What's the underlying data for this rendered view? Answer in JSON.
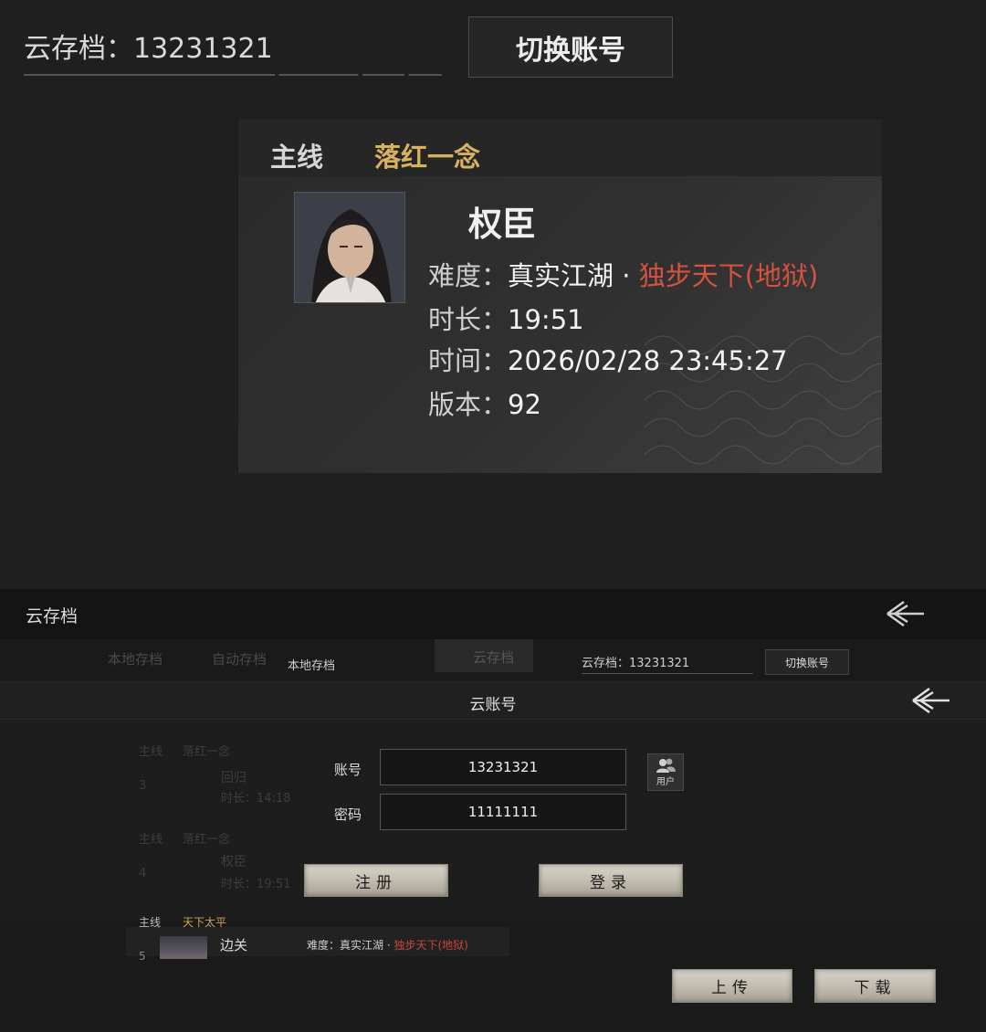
{
  "top": {
    "cloud_label": "云存档：13231321",
    "switch_label": "切换账号",
    "card": {
      "tab_main": "主线",
      "story": "落红一念",
      "name": "权臣",
      "difficulty_label": "难度：",
      "difficulty_value": "真实江湖",
      "difficulty_sep": "·",
      "difficulty_hell": "独步天下(地狱)",
      "duration_label": "时长：",
      "duration_value": "19:51",
      "time_label": "时间：",
      "time_value": "2026/02/28 23:45:27",
      "version_label": "版本：",
      "version_value": "92"
    }
  },
  "bottom": {
    "title": "云存档",
    "tabs": [
      "本地存档",
      "自动存档",
      "本地存档",
      "云存档"
    ],
    "cloud_small": "云存档：13231321",
    "switch_small": "切换账号",
    "bg_rows": [
      {
        "main": "主线",
        "story": "落红一念",
        "num": "3",
        "name": "回归",
        "time": "时长：14:18"
      },
      {
        "main": "主线",
        "story": "落红一念",
        "num": "4",
        "name": "权臣",
        "time": "时长：19:51"
      }
    ],
    "dialog": {
      "title": "云账号",
      "account_label": "账号",
      "account_value": "13231321",
      "password_label": "密码",
      "password_value": "11111111",
      "user_label": "用户",
      "register": "注册",
      "login": "登录"
    },
    "row5": {
      "main": "主线",
      "story": "天下太平",
      "num": "5",
      "name": "边关",
      "diff_prefix": "难度：真实江湖 · ",
      "diff_hell": "独步天下(地狱)"
    },
    "upload": "上传",
    "download": "下载"
  }
}
